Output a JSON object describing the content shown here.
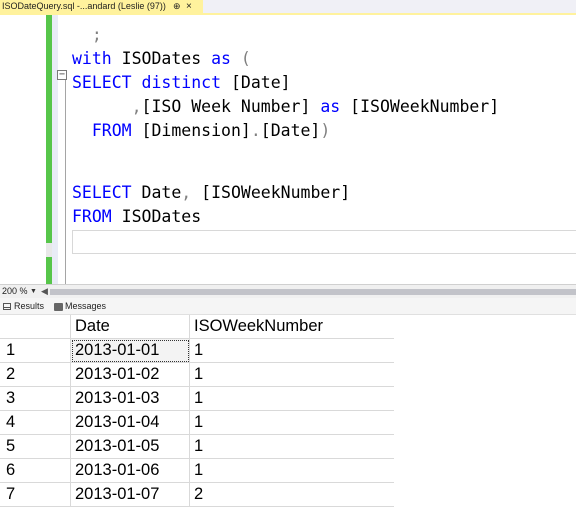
{
  "tab": {
    "title": "ISODateQuery.sql -...andard (Leslie (97))",
    "pin": "⊕",
    "close": "×"
  },
  "editor": {
    "lines": [
      {
        "parts": [
          {
            "t": "  ;",
            "c": "op"
          }
        ]
      },
      {
        "parts": [
          {
            "t": "with ",
            "c": "kw"
          },
          {
            "t": "ISODates ",
            "c": "br"
          },
          {
            "t": "as ",
            "c": "kw"
          },
          {
            "t": "(",
            "c": "op"
          }
        ]
      },
      {
        "parts": [
          {
            "t": "SELECT ",
            "c": "kw"
          },
          {
            "t": "distinct ",
            "c": "kw"
          },
          {
            "t": "[Date]",
            "c": "br"
          }
        ]
      },
      {
        "parts": [
          {
            "t": "      ,",
            "c": "op"
          },
          {
            "t": "[ISO Week Number] ",
            "c": "br"
          },
          {
            "t": "as ",
            "c": "kw"
          },
          {
            "t": "[ISOWeekNumber]",
            "c": "br"
          }
        ]
      },
      {
        "parts": [
          {
            "t": "  FROM ",
            "c": "kw"
          },
          {
            "t": "[Dimension]",
            "c": "br"
          },
          {
            "t": ".",
            "c": "op"
          },
          {
            "t": "[Date]",
            "c": "br"
          },
          {
            "t": ")",
            "c": "op"
          }
        ]
      },
      {
        "parts": []
      },
      {
        "parts": [
          {
            "t": "SELECT ",
            "c": "kw"
          },
          {
            "t": "Date",
            "c": "br"
          },
          {
            "t": ", ",
            "c": "op"
          },
          {
            "t": "[ISOWeekNumber]",
            "c": "br"
          }
        ]
      },
      {
        "parts": [
          {
            "t": "FROM ",
            "c": "kw"
          },
          {
            "t": "ISODates",
            "c": "br"
          }
        ]
      }
    ]
  },
  "status": {
    "zoom": "200 %",
    "zoom_arrow": "▼",
    "scroll_left": "◀"
  },
  "results_tabs": {
    "results": "Results",
    "messages": "Messages"
  },
  "grid": {
    "columns": [
      "",
      "Date",
      "ISOWeekNumber"
    ],
    "rows": [
      [
        "1",
        "2013-01-01",
        "1"
      ],
      [
        "2",
        "2013-01-02",
        "1"
      ],
      [
        "3",
        "2013-01-03",
        "1"
      ],
      [
        "4",
        "2013-01-04",
        "1"
      ],
      [
        "5",
        "2013-01-05",
        "1"
      ],
      [
        "6",
        "2013-01-06",
        "1"
      ],
      [
        "7",
        "2013-01-07",
        "2"
      ]
    ]
  },
  "colors": {
    "tab_active": "#fff29d",
    "keyword": "#0000ff",
    "operator": "#808080",
    "change_bar": "#57c64a"
  }
}
